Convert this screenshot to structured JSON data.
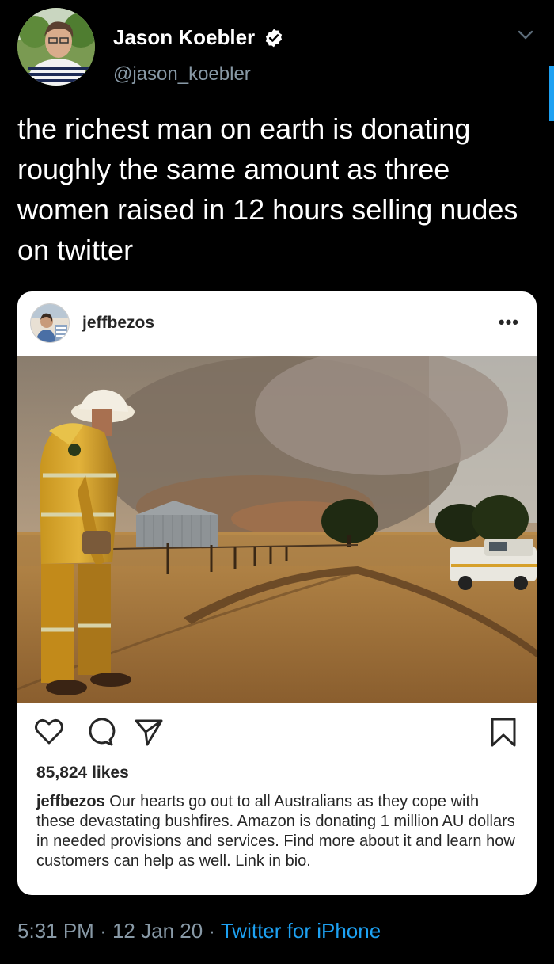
{
  "tweet": {
    "display_name": "Jason Koebler",
    "handle": "@jason_koebler",
    "text": "the richest man on earth is donating roughly the same amount as three women raised in 12 hours selling nudes on twitter",
    "time": "5:31 PM",
    "date": "12 Jan 20",
    "separator": "·",
    "source": "Twitter for iPhone"
  },
  "icons": {
    "verified": "verified-badge-icon",
    "chevron": "chevron-down-icon",
    "more": "more-dots-icon",
    "like": "heart-icon",
    "comment": "comment-icon",
    "share": "send-icon",
    "save": "bookmark-icon"
  },
  "embed": {
    "username": "jeffbezos",
    "more_label": "•••",
    "likes": "85,824 likes",
    "caption_user": "jeffbezos",
    "caption_text": "Our hearts go out to all Australians as they cope with these devastating bushfires. Amazon is donating 1 million AU dollars in needed provisions and services. Find more about it and learn how customers can help as well. Link in bio."
  },
  "colors": {
    "background": "#000000",
    "secondary_text": "#8899a6",
    "link": "#1da1f2"
  }
}
